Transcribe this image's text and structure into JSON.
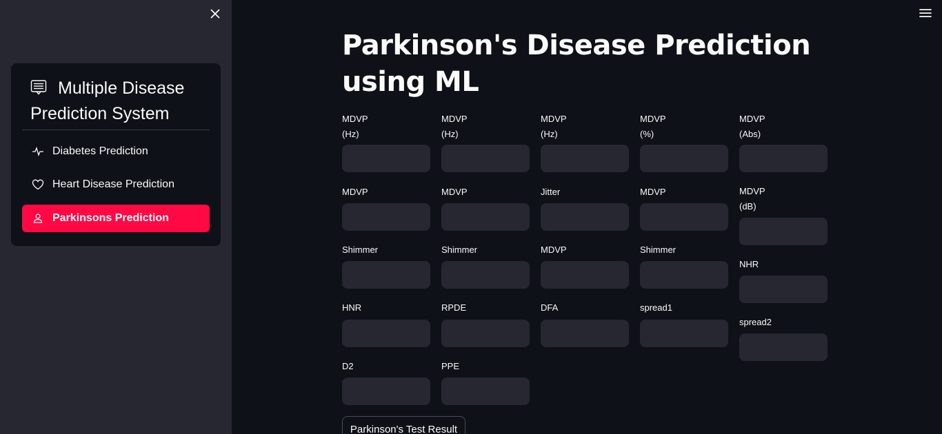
{
  "sidebar": {
    "title": "Multiple Disease Prediction System",
    "title_icon": "chat-list-icon",
    "items": [
      {
        "label": "Diabetes Prediction",
        "icon": "activity-icon",
        "active": false
      },
      {
        "label": "Heart Disease Prediction",
        "icon": "heart-icon",
        "active": false
      },
      {
        "label": "Parkinsons Prediction",
        "icon": "person-icon",
        "active": true
      }
    ],
    "accent_color": "#ff0844"
  },
  "main": {
    "title": "Parkinson's Disease Prediction using ML",
    "fields": [
      {
        "label": "MDVP\n(Hz)",
        "value": ""
      },
      {
        "label": "MDVP\n(Hz)",
        "value": ""
      },
      {
        "label": "MDVP\n(Hz)",
        "value": ""
      },
      {
        "label": "MDVP\n(%)",
        "value": ""
      },
      {
        "label": "MDVP\n(Abs)",
        "value": ""
      },
      {
        "label": "MDVP",
        "value": ""
      },
      {
        "label": "MDVP",
        "value": ""
      },
      {
        "label": "Jitter",
        "value": ""
      },
      {
        "label": "MDVP",
        "value": ""
      },
      {
        "label": "MDVP\n(dB)",
        "value": ""
      },
      {
        "label": "Shimmer",
        "value": ""
      },
      {
        "label": "Shimmer",
        "value": ""
      },
      {
        "label": "MDVP",
        "value": ""
      },
      {
        "label": "Shimmer",
        "value": ""
      },
      {
        "label": "NHR",
        "value": ""
      },
      {
        "label": "HNR",
        "value": ""
      },
      {
        "label": "RPDE",
        "value": ""
      },
      {
        "label": "DFA",
        "value": ""
      },
      {
        "label": "spread1",
        "value": ""
      },
      {
        "label": "spread2",
        "value": ""
      },
      {
        "label": "D2",
        "value": ""
      },
      {
        "label": "PPE",
        "value": ""
      }
    ],
    "result_button": "Parkinson's Test Result"
  },
  "colors": {
    "background": "#0e1117",
    "sidebar_bg": "#262730",
    "input_bg": "#262730"
  }
}
